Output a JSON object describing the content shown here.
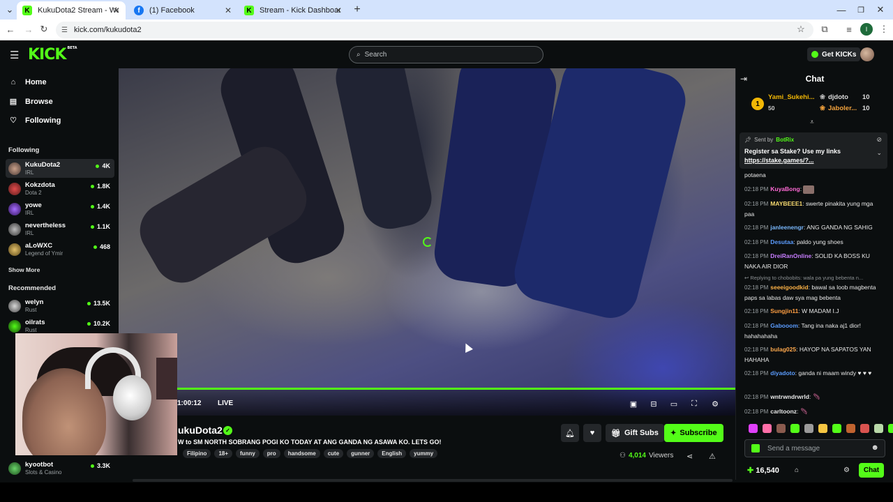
{
  "browser": {
    "tabs": [
      {
        "title": "KukuDota2 Stream - Watch Live",
        "icon": "kick",
        "active": true
      },
      {
        "title": "(1) Facebook",
        "icon": "facebook",
        "active": false
      },
      {
        "title": "Stream - Kick Dashboard",
        "icon": "kick",
        "active": false
      }
    ],
    "url": "kick.com/kukudota2",
    "profile_initial": "I"
  },
  "header": {
    "logo": "KICK",
    "logo_badge": "BETA",
    "search_placeholder": "Search",
    "get_kicks": "Get KICKs"
  },
  "sidebar": {
    "nav": [
      {
        "label": "Home",
        "icon": "home-icon"
      },
      {
        "label": "Browse",
        "icon": "browse-icon"
      },
      {
        "label": "Following",
        "icon": "heart-icon"
      }
    ],
    "following_title": "Following",
    "following": [
      {
        "name": "KukuDota2",
        "category": "IRL",
        "viewers": "4K"
      },
      {
        "name": "Kokzdota",
        "category": "Dota 2",
        "viewers": "1.8K"
      },
      {
        "name": "yowe",
        "category": "IRL",
        "viewers": "1.4K"
      },
      {
        "name": "nevertheless",
        "category": "IRL",
        "viewers": "1.1K"
      },
      {
        "name": "aLoWXC",
        "category": "Legend of Ymir",
        "viewers": "468"
      }
    ],
    "show_more": "Show More",
    "recommended_title": "Recommended",
    "recommended": [
      {
        "name": "welyn",
        "category": "Rust",
        "viewers": "13.5K"
      },
      {
        "name": "oilrats",
        "category": "Rust",
        "viewers": "10.2K"
      }
    ],
    "bottom_channel": {
      "name": "kyootbot",
      "category": "Slots & Casino",
      "viewers": "3.3K"
    }
  },
  "player": {
    "time": "1:00:12",
    "live_label": "LIVE"
  },
  "stream": {
    "streamer": "ukuDota2",
    "title": "W to SM NORTH SOBRANG POGI KO TODAY AT ANG GANDA NG ASAWA KO. LETS GO!",
    "tags": [
      "Filipino",
      "18+",
      "funny",
      "pro",
      "handsome",
      "cute",
      "gunner",
      "English",
      "yummy"
    ],
    "gift_subs": "Gift Subs",
    "subscribe": "Subscribe",
    "viewers_count": "4,014",
    "viewers_label": "Viewers"
  },
  "chat": {
    "title": "Chat",
    "leaderboard": [
      {
        "rank": "1",
        "name": "Yami_Sukehi...",
        "amount": "50"
      },
      {
        "name": "djdoto",
        "amount": "10"
      },
      {
        "name": "Jaboler...",
        "amount": "10"
      }
    ],
    "pinned": {
      "sent_by": "Sent by",
      "bot": "BotRix",
      "message": "Register sa Stake? Use my links",
      "link": "https://stake.games/?..."
    },
    "partial_line": "potaena",
    "messages": [
      {
        "time": "02:18 PM",
        "user": "KuyaBong",
        "color": "#ff6ad5",
        "text": ""
      },
      {
        "time": "02:18 PM",
        "user": "MAYBEEE1",
        "color": "#f5d76e",
        "text": "swerte pinakita yung mga paa"
      },
      {
        "time": "02:18 PM",
        "user": "janleenengr",
        "color": "#7ab8ff",
        "text": "ANG GANDA NG SAHIG"
      },
      {
        "time": "02:18 PM",
        "user": "Desutaa",
        "color": "#5b9cff",
        "text": "paldo yung shoes"
      },
      {
        "time": "02:18 PM",
        "user": "DreiRanOnline",
        "color": "#c77dff",
        "text": "SOLID KA BOSS KU NAKA AIR DIOR"
      },
      {
        "time": "02:18 PM",
        "user": "seeeigoodkid",
        "color": "#ffb347",
        "text": "bawal sa loob magbenta paps sa labas daw sya mag bebenta"
      },
      {
        "time": "02:18 PM",
        "user": "Sungjin11",
        "color": "#ff9f43",
        "text": "W MADAM I.J"
      },
      {
        "time": "02:18 PM",
        "user": "Gabooom",
        "color": "#5b9cff",
        "text": "Tang ina naka aj1 dior! hahahahaha"
      },
      {
        "time": "02:18 PM",
        "user": "bulag025",
        "color": "#ffa94d",
        "text": "HAYOP NA SAPATOS YAN HAHAHA"
      },
      {
        "time": "02:18 PM",
        "user": "diyadoto",
        "color": "#5b9cff",
        "text": "ganda ni maam windy ♥ ♥ ♥"
      },
      {
        "time": "02:18 PM",
        "user": "wntrwndrwrld",
        "color": "#ffffff",
        "text": ""
      },
      {
        "time": "02:18 PM",
        "user": "carltoonz",
        "color": "#ffffff",
        "text": ""
      }
    ],
    "reply_note": "Replying to chobobits: wala pa yung bebenta n...",
    "input_placeholder": "Send a message",
    "points": "16,540",
    "chat_button": "Chat"
  },
  "colors": {
    "brand_green": "#53fc18",
    "background": "#0b0e0f",
    "panel": "#24272a"
  }
}
